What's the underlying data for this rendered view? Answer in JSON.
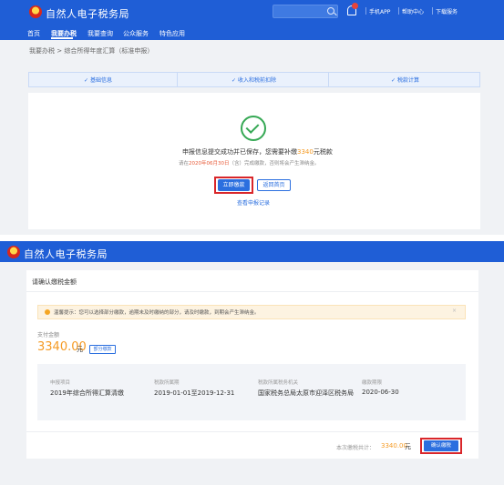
{
  "header": {
    "brand": "自然人电子税务局",
    "links": [
      "手机APP",
      "帮助中心",
      "下载服务"
    ]
  },
  "nav": [
    "首页",
    "我要办税",
    "我要查询",
    "公众服务",
    "特色应用"
  ],
  "breadcrumb": "我要办税  >  综合所得年度汇算（标准申报）",
  "steps": [
    "基础信息",
    "收入和税前扣除",
    "税款计算"
  ],
  "result": {
    "msg_before": "申报信息提交成功并已保存，您需要补缴",
    "amount": "3340",
    "msg_after": "元税款",
    "sub_before": "请在",
    "deadline": "2020年06月30日",
    "sub_after": "（含）完成缴款，否则将会产生滞纳金。",
    "pay_button": "立即缴款",
    "back_button": "返回首页",
    "record_link": "查看申报记录"
  },
  "confirm": {
    "brand": "自然人电子税务局",
    "title": "请确认缴税金额",
    "notice": "温馨提示：您可以选择部分缴款，逾期未及时缴纳的部分，请及时缴款，到期会产生滞纳金。",
    "pay_label": "支付金额",
    "amount": "3340.00",
    "unit": "元",
    "partial_button": "部分缴款",
    "fields": [
      {
        "label": "申报项目",
        "value": "2019年综合所得汇算清缴"
      },
      {
        "label": "税款所属期",
        "value": "2019-01-01至2019-12-31"
      },
      {
        "label": "税款所属税务机关",
        "value": "国家税务总局太原市迎泽区税务局"
      },
      {
        "label": "缴款期限",
        "value": "2020-06-30"
      }
    ],
    "total_label": "本次缴税共计：",
    "total_value": "3340.00",
    "total_unit": "元",
    "confirm_button": "确认缴税"
  },
  "colors": {
    "primary": "#1f5ed6",
    "accent": "#f59a23",
    "highlight": "#d9262a",
    "success": "#35a854"
  }
}
